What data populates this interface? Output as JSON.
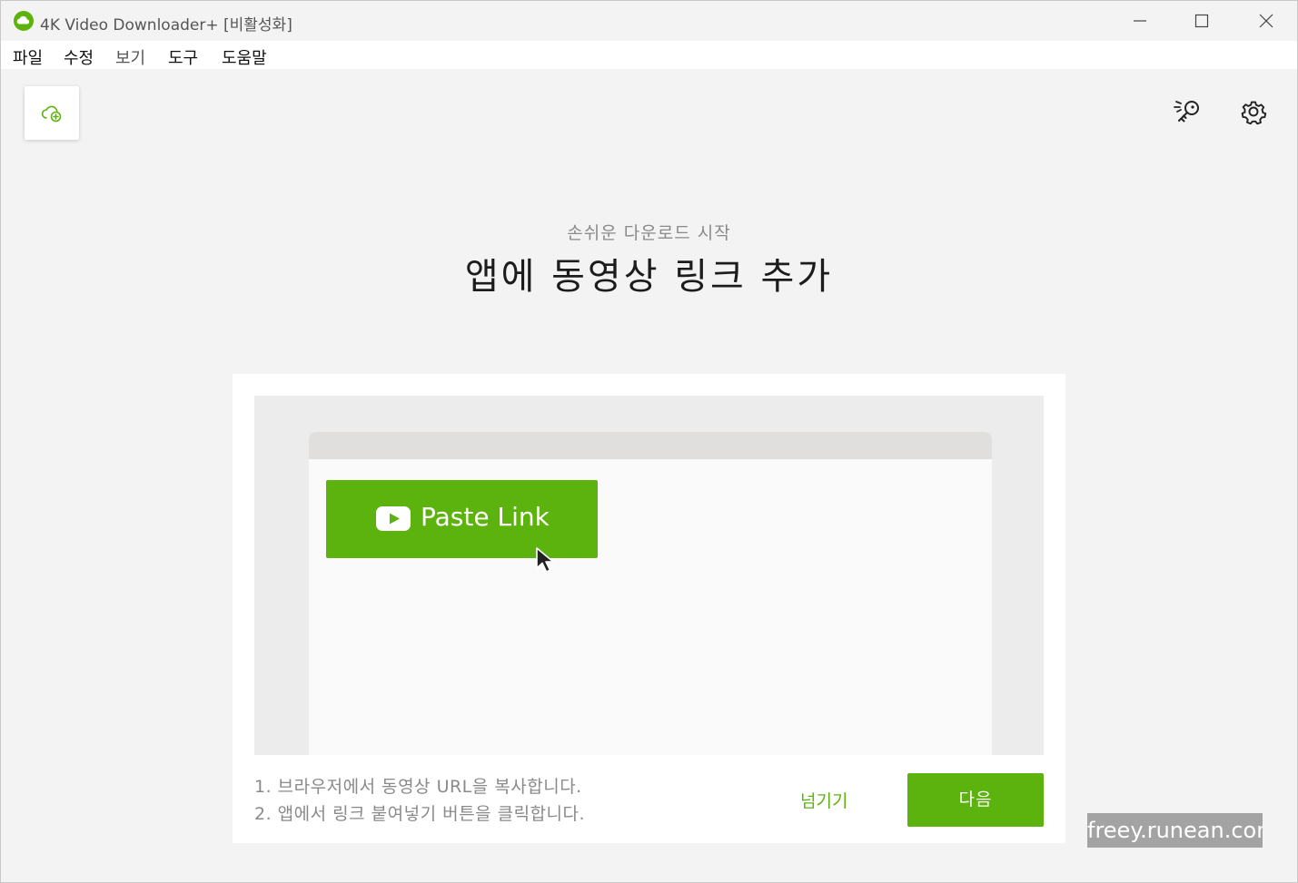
{
  "window": {
    "title": "4K Video Downloader+ [비활성화]"
  },
  "menu": {
    "file": "파일",
    "edit": "수정",
    "view": "보기",
    "tools": "도구",
    "help": "도움말"
  },
  "toolbar": {
    "add_link_icon": "cloud-add-icon",
    "smart_mode_icon": "magic-key-icon",
    "settings_icon": "gear-icon"
  },
  "hero": {
    "subtitle": "손쉬운 다운로드 시작",
    "title": "앱에 동영상 링크 추가"
  },
  "illustration": {
    "paste_button_label": "Paste Link"
  },
  "instructions": {
    "step1": "1. 브라우저에서 동영상 URL을 복사합니다.",
    "step2": "2. 앱에서 링크 붙여넣기 버튼을 클릭합니다."
  },
  "actions": {
    "skip": "넘기기",
    "next": "다음"
  },
  "watermark": {
    "text": "freey.runean.com"
  },
  "colors": {
    "accent": "#5cb30d",
    "background": "#f3f3f3"
  }
}
